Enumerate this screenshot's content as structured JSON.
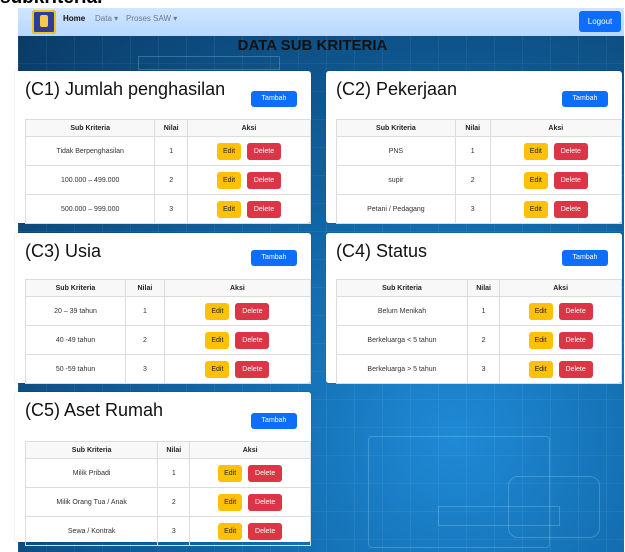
{
  "page": {
    "top_title_fragment": "subkriteria.",
    "title": "DATA SUB KRITERIA"
  },
  "navbar": {
    "home": "Home",
    "data": "Data ▾",
    "proses": "Proses SAW ▾",
    "logout": "Logout"
  },
  "table_headers": {
    "sub": "Sub Kriteria",
    "nilai": "Nilai",
    "aksi": "Aksi"
  },
  "buttons": {
    "tambah": "Tambah",
    "edit": "Edit",
    "delete": "Delete"
  },
  "cards": [
    {
      "title": "(C1) Jumlah penghasilan",
      "rows": [
        {
          "sub": "Tidak Berpenghasilan",
          "nilai": "1"
        },
        {
          "sub": "100.000 – 499.000",
          "nilai": "2"
        },
        {
          "sub": "500.000 – 999.000",
          "nilai": "3"
        }
      ]
    },
    {
      "title": "(C2) Pekerjaan",
      "rows": [
        {
          "sub": "PNS",
          "nilai": "1"
        },
        {
          "sub": "supir",
          "nilai": "2"
        },
        {
          "sub": "Petani / Pedagang",
          "nilai": "3"
        }
      ]
    },
    {
      "title": "(C3) Usia",
      "rows": [
        {
          "sub": "20 – 39 tahun",
          "nilai": "1"
        },
        {
          "sub": "40 -49 tahun",
          "nilai": "2"
        },
        {
          "sub": "50 -59 tahun",
          "nilai": "3"
        }
      ]
    },
    {
      "title": "(C4) Status",
      "rows": [
        {
          "sub": "Belum Menikah",
          "nilai": "1"
        },
        {
          "sub": "Berkeluarga < 5 tahun",
          "nilai": "2"
        },
        {
          "sub": "Berkeluarga > 5 tahun",
          "nilai": "3"
        }
      ]
    },
    {
      "title": "(C5) Aset Rumah",
      "rows": [
        {
          "sub": "Milik Pribadi",
          "nilai": "1"
        },
        {
          "sub": "Milik Orang Tua / Anak",
          "nilai": "2"
        },
        {
          "sub": "Sewa / Kontrak",
          "nilai": "3"
        }
      ]
    }
  ]
}
